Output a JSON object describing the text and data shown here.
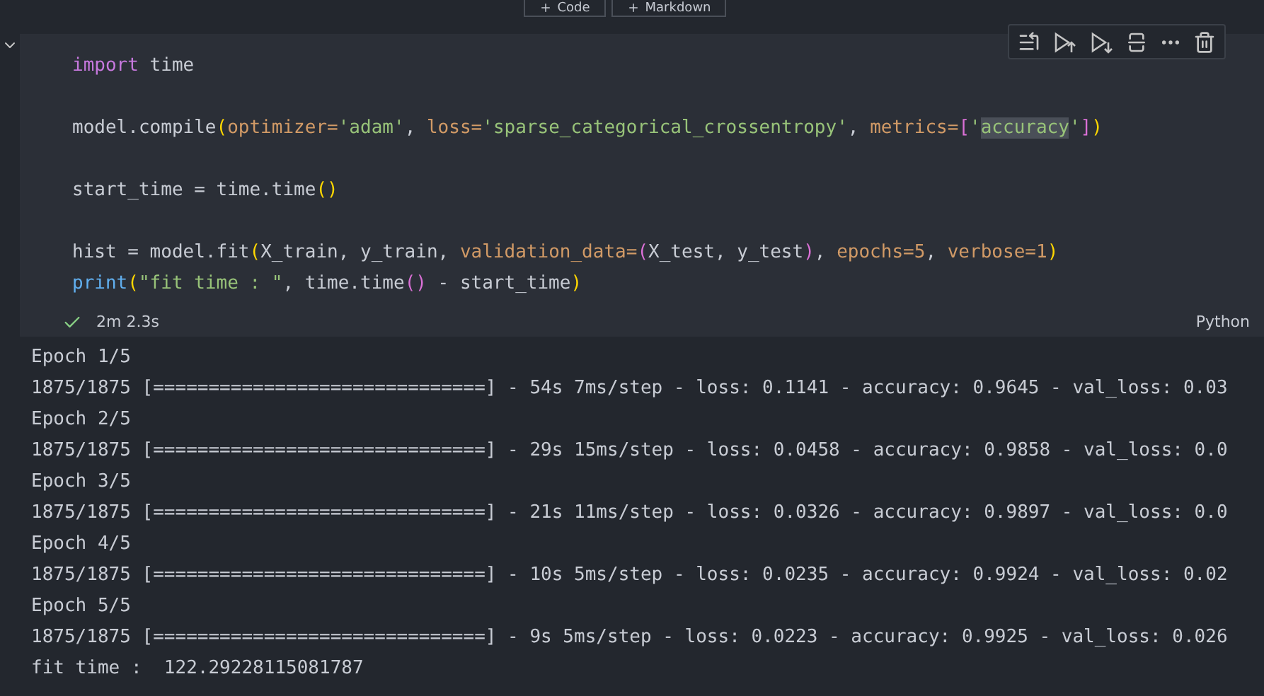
{
  "top_buttons": [
    {
      "label": "Code"
    },
    {
      "label": "Markdown"
    }
  ],
  "cell": {
    "expanded": true,
    "code_lines": [
      {
        "blank_after": true,
        "tokens": [
          {
            "kind": "keyword",
            "text": "import"
          },
          {
            "kind": "plain",
            "text": " time"
          }
        ]
      },
      {
        "blank_after": true,
        "tokens": [
          {
            "kind": "plain",
            "text": "model.compile"
          },
          {
            "kind": "bracket0",
            "text": "("
          },
          {
            "kind": "param",
            "text": "optimizer="
          },
          {
            "kind": "string",
            "text": "'adam'"
          },
          {
            "kind": "plain",
            "text": ", "
          },
          {
            "kind": "param",
            "text": "loss="
          },
          {
            "kind": "string",
            "text": "'sparse_categorical_crossentropy'"
          },
          {
            "kind": "plain",
            "text": ", "
          },
          {
            "kind": "param",
            "text": "metrics="
          },
          {
            "kind": "bracket1",
            "text": "["
          },
          {
            "kind": "string",
            "text": "'"
          },
          {
            "kind": "highlight",
            "text": "accuracy"
          },
          {
            "kind": "string",
            "text": "'"
          },
          {
            "kind": "bracket1",
            "text": "]"
          },
          {
            "kind": "bracket0",
            "text": ")"
          }
        ]
      },
      {
        "blank_after": true,
        "tokens": [
          {
            "kind": "plain",
            "text": "start_time = time.time"
          },
          {
            "kind": "bracket0",
            "text": "()"
          }
        ]
      },
      {
        "blank_after": false,
        "tokens": [
          {
            "kind": "plain",
            "text": "hist = model.fit"
          },
          {
            "kind": "bracket0",
            "text": "("
          },
          {
            "kind": "plain",
            "text": "X_train, y_train, "
          },
          {
            "kind": "param",
            "text": "validation_data="
          },
          {
            "kind": "bracket1",
            "text": "("
          },
          {
            "kind": "plain",
            "text": "X_test, y_test"
          },
          {
            "kind": "bracket1",
            "text": ")"
          },
          {
            "kind": "plain",
            "text": ", "
          },
          {
            "kind": "param",
            "text": "epochs=5"
          },
          {
            "kind": "plain",
            "text": ", "
          },
          {
            "kind": "param",
            "text": "verbose=1"
          },
          {
            "kind": "bracket0",
            "text": ")"
          }
        ]
      },
      {
        "blank_after": false,
        "tokens": [
          {
            "kind": "function",
            "text": "print"
          },
          {
            "kind": "bracket0",
            "text": "("
          },
          {
            "kind": "string",
            "text": "\"fit time : \""
          },
          {
            "kind": "plain",
            "text": ", time.time"
          },
          {
            "kind": "bracket1",
            "text": "()"
          },
          {
            "kind": "plain",
            "text": " - start_time"
          },
          {
            "kind": "bracket0",
            "text": ")"
          }
        ]
      }
    ],
    "status": {
      "success": true,
      "duration": "2m 2.3s",
      "language": "Python"
    },
    "output_lines": [
      "Epoch 1/5",
      "1875/1875 [==============================] - 54s 7ms/step - loss: 0.1141 - accuracy: 0.9645 - val_loss: 0.03",
      "Epoch 2/5",
      "1875/1875 [==============================] - 29s 15ms/step - loss: 0.0458 - accuracy: 0.9858 - val_loss: 0.0",
      "Epoch 3/5",
      "1875/1875 [==============================] - 21s 11ms/step - loss: 0.0326 - accuracy: 0.9897 - val_loss: 0.0",
      "Epoch 4/5",
      "1875/1875 [==============================] - 10s 5ms/step - loss: 0.0235 - accuracy: 0.9924 - val_loss: 0.02",
      "Epoch 5/5",
      "1875/1875 [==============================] - 9s 5ms/step - loss: 0.0223 - accuracy: 0.9925 - val_loss: 0.026",
      "fit time :  122.29228115081787"
    ]
  }
}
